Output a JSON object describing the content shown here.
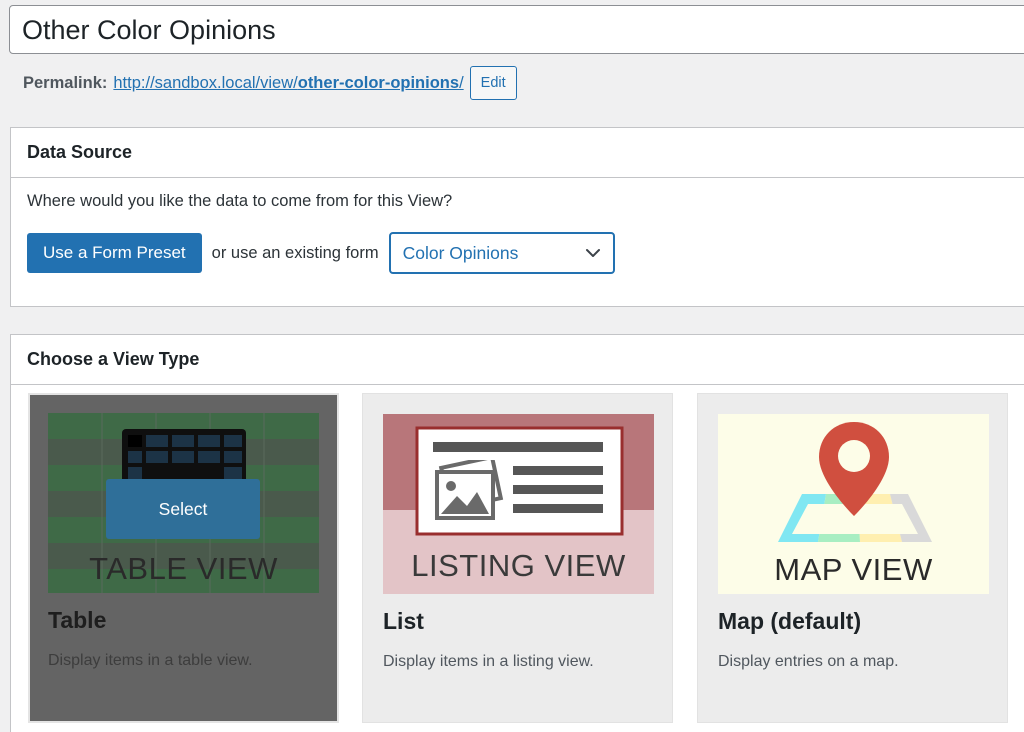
{
  "post_title": "Other Color Opinions",
  "permalink": {
    "label": "Permalink:",
    "url_base": "http://sandbox.local/view/",
    "url_slug": "other-color-opinions",
    "url_trail": "/",
    "edit_label": "Edit"
  },
  "data_source": {
    "heading": "Data Source",
    "question": "Where would you like the data to come from for this View?",
    "preset_button": "Use a Form Preset",
    "or_text": "or use an existing form",
    "selected_form": "Color Opinions"
  },
  "view_type": {
    "heading": "Choose a View Type",
    "cards": [
      {
        "thumb_label": "TABLE VIEW",
        "title": "Table",
        "description": "Display items in a table view.",
        "selected": true,
        "select_label": "Select"
      },
      {
        "thumb_label": "LISTING VIEW",
        "title": "List",
        "description": "Display items in a listing view."
      },
      {
        "thumb_label": "MAP VIEW",
        "title": "Map (default)",
        "description": "Display entries on a map."
      }
    ]
  },
  "colors": {
    "accent": "#2271b1",
    "selected_overlay": "#646464",
    "listing_top": "#b8767a",
    "listing_bottom": "#e3c4c7",
    "listing_frame": "#992e2e",
    "map_bg": "#fdfde8",
    "map_pin": "#d04f3f"
  },
  "icons": [
    "chevron-down-icon",
    "table-icon",
    "listing-icon",
    "image-icon",
    "map-pin-icon"
  ]
}
